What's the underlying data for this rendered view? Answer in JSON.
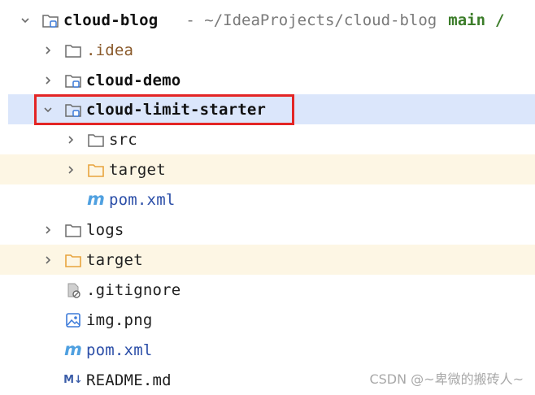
{
  "root": {
    "name": "cloud-blog",
    "path": "- ~/IdeaProjects/cloud-blog",
    "branch": "main",
    "trailing": "/"
  },
  "items": [
    {
      "label": ".idea"
    },
    {
      "label": "cloud-demo"
    },
    {
      "label": "cloud-limit-starter"
    },
    {
      "label": "src"
    },
    {
      "label": "target"
    },
    {
      "label": "pom.xml"
    },
    {
      "label": "logs"
    },
    {
      "label": "target"
    },
    {
      "label": ".gitignore"
    },
    {
      "label": "img.png"
    },
    {
      "label": "pom.xml"
    },
    {
      "label": "README.md"
    }
  ],
  "icons": {
    "maven": "m",
    "markdown": "M↓"
  },
  "colors": {
    "selected_row": "#dbe6fb",
    "excluded_row": "#fdf6e4",
    "highlight_border": "#e32525",
    "folder_orange": "#e8a33d"
  },
  "watermark": "CSDN @~卑微的搬砖人~"
}
